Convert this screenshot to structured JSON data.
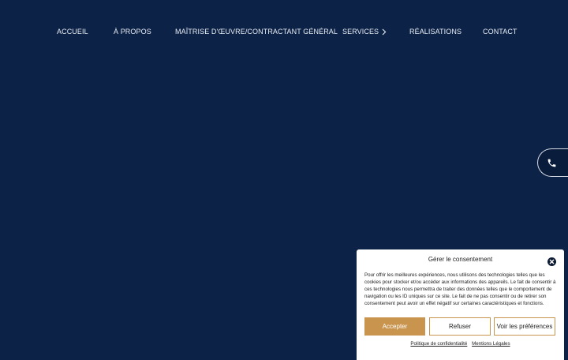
{
  "nav": {
    "items": [
      {
        "label": "ACCUEIL"
      },
      {
        "label": "À PROPOS"
      },
      {
        "label": "MAÎTRISE D'ŒUVRE/CONTRACTANT GÉNÉRAL"
      },
      {
        "label": "SERVICES",
        "icon": "chevron-right-icon"
      },
      {
        "label": "RÉALISATIONS"
      },
      {
        "label": "CONTACT"
      }
    ]
  },
  "phone_tab": {
    "icon": "phone-icon"
  },
  "consent": {
    "title": "Gérer le consentement",
    "body": "Pour offrir les meilleures expériences, nous utilisons des technologies telles que les cookies pour stocker et/ou accéder aux informations des appareils. Le fait de consentir à ces technologies nous permettra de traiter des données telles que le comportement de navigation ou les ID uniques sur ce site. Le fait de ne pas consentir ou de retirer son consentement peut avoir un effet négatif sur certaines caractéristiques et fonctions.",
    "accept_label": "Accepter",
    "refuse_label": "Refuser",
    "preferences_label": "Voir les préférences",
    "privacy_link": "Politique de confidentialité",
    "legal_link": "Mentions Légales"
  },
  "colors": {
    "background": "#0c2247",
    "accent": "#c9954e",
    "nav_text": "#eaeef5"
  }
}
